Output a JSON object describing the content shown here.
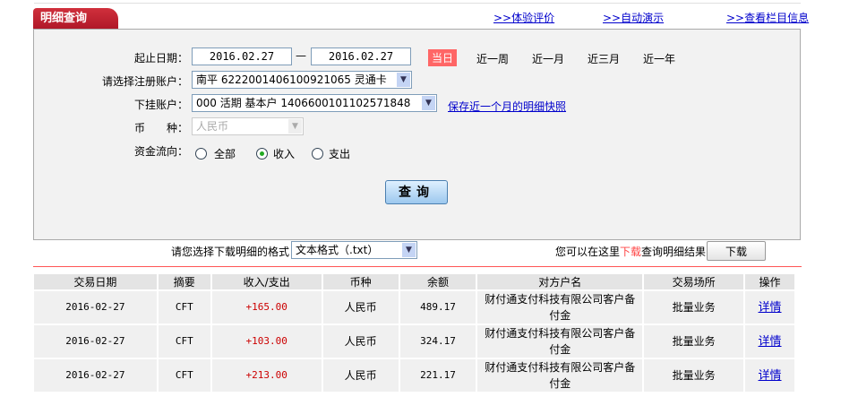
{
  "tab_title": "明细查询",
  "top_links": [
    ">>体验评价",
    ">>自动演示",
    ">>查看栏目信息"
  ],
  "form": {
    "date_label": "起止日期：",
    "date_from": "2016.02.27",
    "date_sep": "—",
    "date_to": "2016.02.27",
    "quick_ranges": [
      "当日",
      "近一周",
      "近一月",
      "近三月",
      "近一年"
    ],
    "account_label": "请选择注册账户：",
    "account_value": "南平 6222001406100921065 灵通卡",
    "sub_account_label": "下挂账户：",
    "sub_account_value": "000 活期 基本户 1406600101102571848",
    "save_link": "保存近一个月的明细快照",
    "currency_label": "币　　种：",
    "currency_value": "人民币",
    "flow_label": "资金流向：",
    "flow_options": [
      "全部",
      "收入",
      "支出"
    ],
    "flow_selected": "收入",
    "query_button": "查询"
  },
  "download": {
    "format_label": "请您选择下载明细的格式",
    "format_value": "文本格式（.txt）",
    "hint_prefix": "您可以在这里",
    "hint_red": "下载",
    "hint_suffix": "查询明细结果",
    "button": "下载"
  },
  "table": {
    "headers": [
      "交易日期",
      "摘要",
      "收入/支出",
      "币种",
      "余额",
      "对方户名",
      "交易场所",
      "操作"
    ],
    "rows": [
      [
        "2016-02-27",
        "CFT",
        "+165.00",
        "人民币",
        "489.17",
        "财付通支付科技有限公司客户备付金",
        "批量业务",
        "详情"
      ],
      [
        "2016-02-27",
        "CFT",
        "+103.00",
        "人民币",
        "324.17",
        "财付通支付科技有限公司客户备付金",
        "批量业务",
        "详情"
      ],
      [
        "2016-02-27",
        "CFT",
        "+213.00",
        "人民币",
        "221.17",
        "财付通支付科技有限公司客户备付金",
        "批量业务",
        "详情"
      ]
    ]
  },
  "colors": {
    "accent": "#c0202e",
    "income": "#cc0000",
    "link": "#0000cc"
  }
}
